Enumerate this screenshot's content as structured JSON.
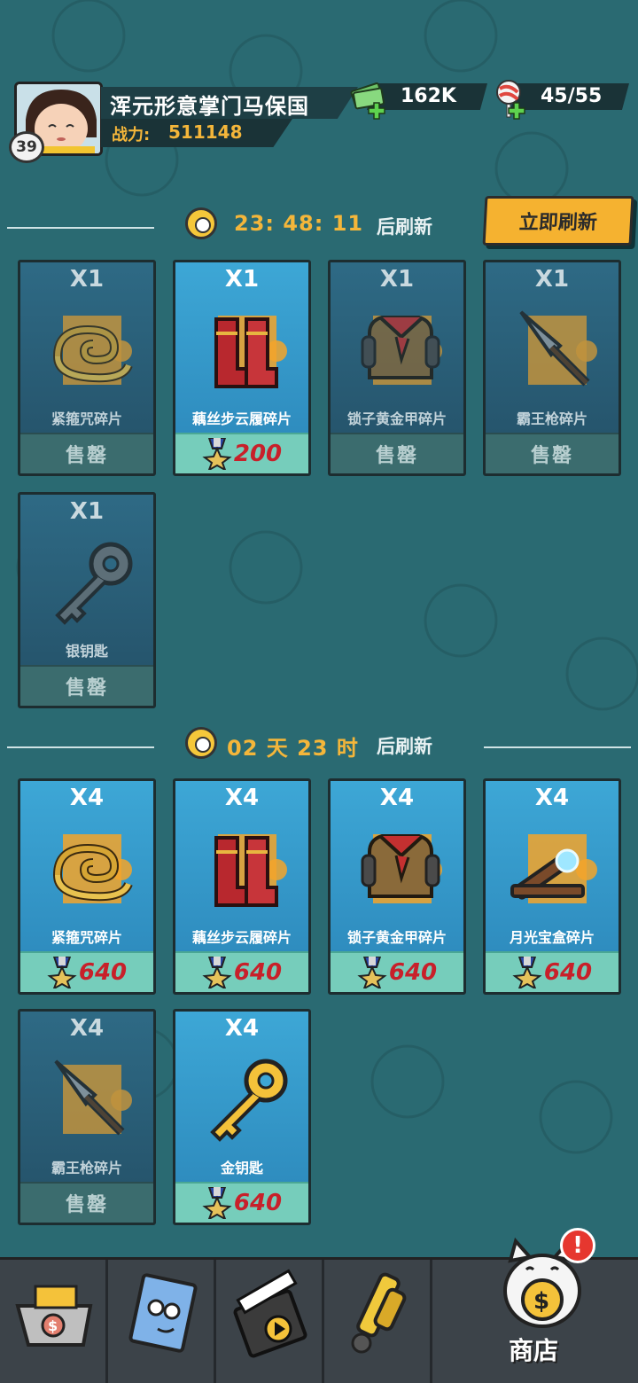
{
  "header": {
    "level": "39",
    "player_name": "浑元形意掌门马保国",
    "power_label": "战力:",
    "power_value": "511148",
    "cash_value": "162K",
    "candy_value": "45/55"
  },
  "section1": {
    "timer": "23: 48: 11",
    "timer_suffix": "后刷新",
    "refresh_button": "立即刷新",
    "items": [
      {
        "qty": "X1",
        "name": "紧箍咒碎片",
        "footer": "售罄",
        "sold": true,
        "icon": "gold-ring-icon"
      },
      {
        "qty": "X1",
        "name": "藕丝步云履碎片",
        "footer": "200",
        "sold": false,
        "icon": "red-boots-icon"
      },
      {
        "qty": "X1",
        "name": "锁子黄金甲碎片",
        "footer": "售罄",
        "sold": true,
        "icon": "armor-icon"
      },
      {
        "qty": "X1",
        "name": "霸王枪碎片",
        "footer": "售罄",
        "sold": true,
        "icon": "spear-icon"
      },
      {
        "qty": "X1",
        "name": "银钥匙",
        "footer": "售罄",
        "sold": true,
        "icon": "silver-key-icon"
      }
    ]
  },
  "section2": {
    "timer": "02 天 23 时",
    "timer_suffix": "后刷新",
    "items": [
      {
        "qty": "X4",
        "name": "紧箍咒碎片",
        "footer": "640",
        "sold": false,
        "icon": "gold-ring-icon"
      },
      {
        "qty": "X4",
        "name": "藕丝步云履碎片",
        "footer": "640",
        "sold": false,
        "icon": "red-boots-icon"
      },
      {
        "qty": "X4",
        "name": "锁子黄金甲碎片",
        "footer": "640",
        "sold": false,
        "icon": "armor-icon"
      },
      {
        "qty": "X4",
        "name": "月光宝盒碎片",
        "footer": "640",
        "sold": false,
        "icon": "moonlight-box-icon"
      },
      {
        "qty": "X4",
        "name": "霸王枪碎片",
        "footer": "售罄",
        "sold": true,
        "icon": "spear-icon"
      },
      {
        "qty": "X4",
        "name": "金钥匙",
        "footer": "640",
        "sold": false,
        "icon": "gold-key-icon"
      }
    ]
  },
  "nav": {
    "shop_label": "商店",
    "alert": "!"
  },
  "colors": {
    "background": "#2a6a72",
    "accent_gold": "#f4b63a",
    "price_red": "#c8202a",
    "refresh_button": "#f5b230"
  }
}
